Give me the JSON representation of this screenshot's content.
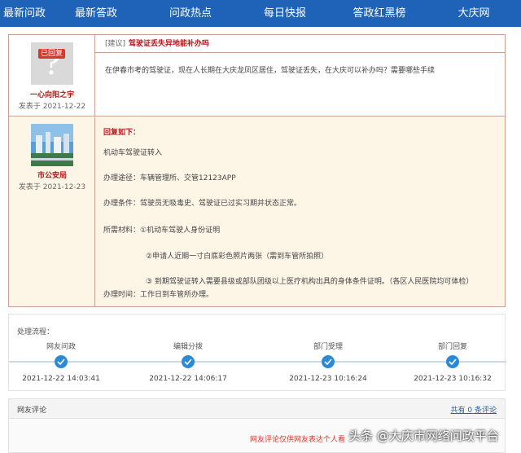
{
  "nav": [
    "最新问政",
    "最新答政",
    "问政热点",
    "每日快报",
    "答政红黑榜",
    "大庆网"
  ],
  "question": {
    "badge": "已回复",
    "user": "一心向阳之宇",
    "date": "发表于 2021-12-22",
    "tag": "[建议]",
    "title": "驾驶证丢失异地能补办吗",
    "body": "在伊春市考的驾驶证，现在人长期在大庆龙凤区居住，驾驶证丢失，在大庆可以补办吗？需要哪些手续"
  },
  "reply": {
    "dept": "市公安局",
    "date": "发表于 2021-12-23",
    "title": "回复如下：",
    "lines": [
      "机动车驾驶证转入",
      "办理途径：车辆管理所、交管12123APP",
      "办理条件：驾驶员无吸毒史、驾驶证已过实习期并状态正常。",
      "所需材料：①机动车驾驶人身份证明",
      "②申请人近期一寸白底彩色照片两张（需到车管所拍照）",
      "③ 到期驾驶证转入需要县级或部队团级以上医疗机构出具的身体条件证明。（各区人民医院均可体检）",
      "办理时间：工作日到车管所办理。"
    ]
  },
  "process": {
    "title": "处理流程：",
    "steps": [
      {
        "label": "网友问政",
        "time": "2021-12-22 14:03:41"
      },
      {
        "label": "编辑分拨",
        "time": "2021-12-22 14:06:17"
      },
      {
        "label": "部门受理",
        "time": "2021-12-23 10:16:24"
      },
      {
        "label": "部门回复",
        "time": "2021-12-23 10:16:32"
      }
    ]
  },
  "comments": {
    "title": "网友评论",
    "count": "共有 0 条评论",
    "note": "网友评论仅供网友表达个人看"
  },
  "watermark": "头条 @大庆市网络问政平台",
  "colors": {
    "nav": "#1e63b8",
    "accent_red": "#b2191c",
    "step": "#2b8ad6"
  }
}
